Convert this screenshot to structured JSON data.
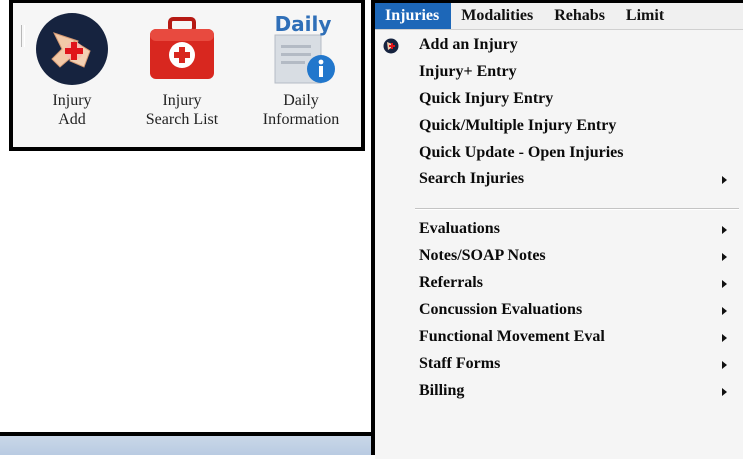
{
  "toolbar": {
    "buttons": [
      {
        "label": "Injury\nAdd",
        "icon": "injured-knee-icon"
      },
      {
        "label": "Injury\nSearch List",
        "icon": "first-aid-kit-icon"
      },
      {
        "label": "Daily\nInformation",
        "icon": "daily-info-icon",
        "icon_text": "Daily"
      }
    ]
  },
  "menubar": {
    "items": [
      "Injuries",
      "Modalities",
      "Rehabs",
      "Limit"
    ],
    "active": "Injuries"
  },
  "dropdown": {
    "items": [
      {
        "label": "Add an Injury",
        "icon": "injury-globe-icon",
        "submenu": false
      },
      {
        "label": "Injury+ Entry",
        "submenu": false
      },
      {
        "label": "Quick Injury Entry",
        "submenu": false
      },
      {
        "label": "Quick/Multiple Injury Entry",
        "submenu": false
      },
      {
        "label": "Quick Update - Open Injuries",
        "submenu": false
      },
      {
        "label": "Search Injuries",
        "submenu": true
      },
      {
        "label": "Evaluations",
        "submenu": true
      },
      {
        "label": "Notes/SOAP Notes",
        "submenu": true
      },
      {
        "label": "Referrals",
        "submenu": true
      },
      {
        "label": "Concussion Evaluations",
        "submenu": true
      },
      {
        "label": "Functional Movement Eval",
        "submenu": true
      },
      {
        "label": "Staff Forms",
        "submenu": true
      },
      {
        "label": "Billing",
        "submenu": true
      }
    ]
  },
  "colors": {
    "menu_highlight": "#1d67b8",
    "kit_red": "#d8271f",
    "status_strip": "#c0d0e6"
  }
}
